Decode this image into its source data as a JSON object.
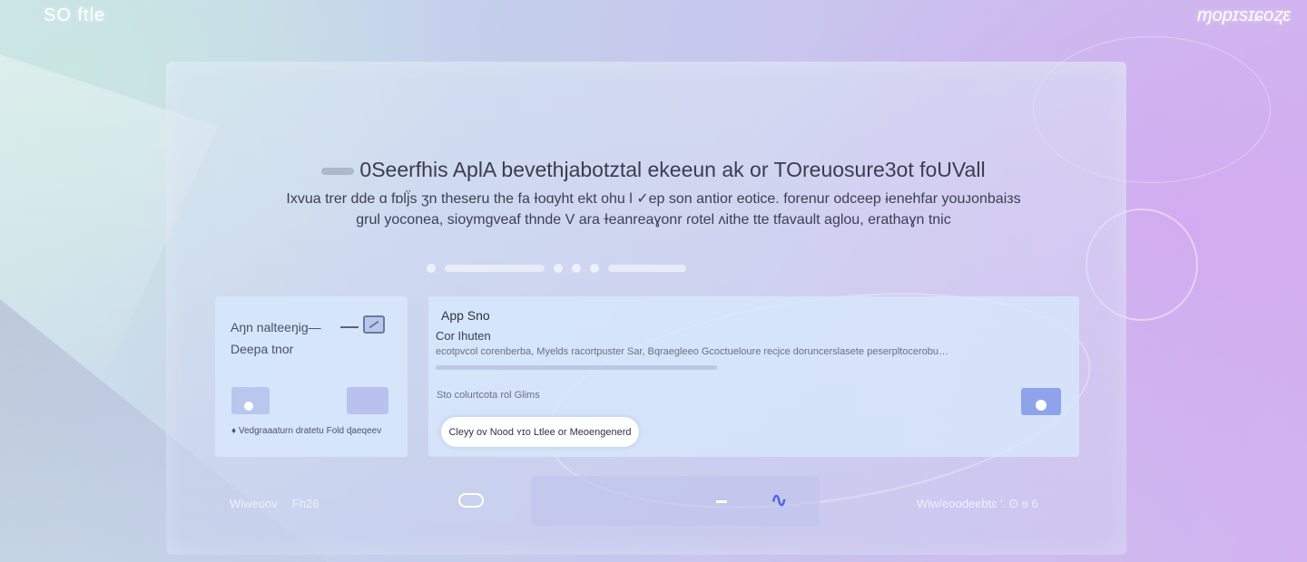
{
  "brand": {
    "left": "SO ftle",
    "right": "ɱopɪsɪɕoⱬɛ"
  },
  "hero": {
    "title": "0Seerfhis AplA bevethjabotztal ekeeun ak or TOreuosure3ot foUVall",
    "subtitle_line1": "Ixvua trer dde ɑ fɒlj̈s ʒn theseru the fa Ɨoɑyht ekt ohu l ✓ep son antior eotice. forenur odceep ɨenehfar youᴊonbaiᴈs",
    "subtitle_line2": "ɡrul yoconea, sioymgveaf thnde V ara ɫeanreaɣonr ɾotel ʌithe tte tfavault aglou, erathaɣn tnic"
  },
  "left_card": {
    "label1": "Aŋn nalteeŋig—",
    "label2": "Deepa tnor",
    "footer": "♦ Vedgraaaturn dratetu Fold ɖaeqeev"
  },
  "right_card": {
    "title": "App Sno",
    "subtitle": "Cor Ihuten",
    "description": "ecotpvcol corenberba, Myelds racortpuster Sar, Bqraegleeo Gcoctueloure recjce doruncerslasete peserpltocerobu…",
    "setting_label": "Sto colurtcota rol Glims",
    "pill_button": "Cleyy ov Nood ʏɪo Ltlee or Meoengenerd"
  },
  "footer": {
    "left_a": "Wiweoov",
    "left_b": "Fh26",
    "right": "Wiw/eoodeebtɛ ʹ. ʘ ɘ 6"
  },
  "colors": {
    "accent": "#8fa3ea",
    "toggle_icon": "#5468d8"
  }
}
